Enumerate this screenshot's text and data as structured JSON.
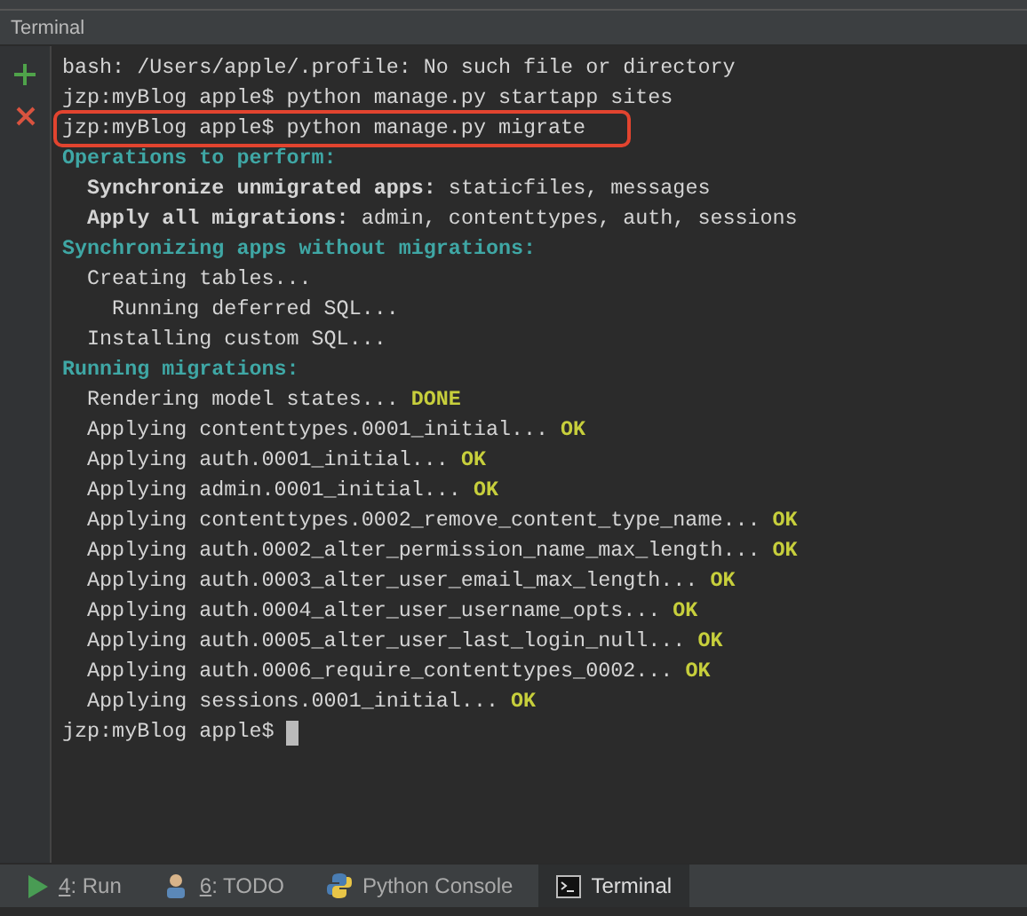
{
  "panel": {
    "title": "Terminal"
  },
  "toolbar": [
    {
      "kind": "add"
    },
    {
      "kind": "close"
    }
  ],
  "lines": [
    {
      "highlighted": false,
      "segments": [
        {
          "kind": "plain",
          "text": "bash: /Users/apple/.profile: No such file or directory"
        }
      ]
    },
    {
      "highlighted": false,
      "segments": [
        {
          "kind": "plain",
          "text": "jzp:myBlog apple$ python manage.py startapp sites"
        }
      ]
    },
    {
      "highlighted": true,
      "segments": [
        {
          "kind": "plain",
          "text": "jzp:myBlog apple$ python manage.py migrate"
        }
      ]
    },
    {
      "highlighted": false,
      "segments": [
        {
          "kind": "heading",
          "text": "Operations to perform:"
        }
      ]
    },
    {
      "highlighted": false,
      "segments": [
        {
          "kind": "bold",
          "text": "  Synchronize unmigrated apps:"
        },
        {
          "kind": "plain",
          "text": " staticfiles, messages"
        }
      ]
    },
    {
      "highlighted": false,
      "segments": [
        {
          "kind": "bold",
          "text": "  Apply all migrations:"
        },
        {
          "kind": "plain",
          "text": " admin, contenttypes, auth, sessions"
        }
      ]
    },
    {
      "highlighted": false,
      "segments": [
        {
          "kind": "heading",
          "text": "Synchronizing apps without migrations:"
        }
      ]
    },
    {
      "highlighted": false,
      "segments": [
        {
          "kind": "plain",
          "text": "  Creating tables..."
        }
      ]
    },
    {
      "highlighted": false,
      "segments": [
        {
          "kind": "plain",
          "text": "    Running deferred SQL..."
        }
      ]
    },
    {
      "highlighted": false,
      "segments": [
        {
          "kind": "plain",
          "text": "  Installing custom SQL..."
        }
      ]
    },
    {
      "highlighted": false,
      "segments": [
        {
          "kind": "heading",
          "text": "Running migrations:"
        }
      ]
    },
    {
      "highlighted": false,
      "segments": [
        {
          "kind": "plain",
          "text": "  Rendering model states... "
        },
        {
          "kind": "ok",
          "text": "DONE"
        }
      ]
    },
    {
      "highlighted": false,
      "segments": [
        {
          "kind": "plain",
          "text": "  Applying contenttypes.0001_initial... "
        },
        {
          "kind": "ok",
          "text": "OK"
        }
      ]
    },
    {
      "highlighted": false,
      "segments": [
        {
          "kind": "plain",
          "text": "  Applying auth.0001_initial... "
        },
        {
          "kind": "ok",
          "text": "OK"
        }
      ]
    },
    {
      "highlighted": false,
      "segments": [
        {
          "kind": "plain",
          "text": "  Applying admin.0001_initial... "
        },
        {
          "kind": "ok",
          "text": "OK"
        }
      ]
    },
    {
      "highlighted": false,
      "segments": [
        {
          "kind": "plain",
          "text": "  Applying contenttypes.0002_remove_content_type_name... "
        },
        {
          "kind": "ok",
          "text": "OK"
        }
      ]
    },
    {
      "highlighted": false,
      "segments": [
        {
          "kind": "plain",
          "text": "  Applying auth.0002_alter_permission_name_max_length... "
        },
        {
          "kind": "ok",
          "text": "OK"
        }
      ]
    },
    {
      "highlighted": false,
      "segments": [
        {
          "kind": "plain",
          "text": "  Applying auth.0003_alter_user_email_max_length... "
        },
        {
          "kind": "ok",
          "text": "OK"
        }
      ]
    },
    {
      "highlighted": false,
      "segments": [
        {
          "kind": "plain",
          "text": "  Applying auth.0004_alter_user_username_opts... "
        },
        {
          "kind": "ok",
          "text": "OK"
        }
      ]
    },
    {
      "highlighted": false,
      "segments": [
        {
          "kind": "plain",
          "text": "  Applying auth.0005_alter_user_last_login_null... "
        },
        {
          "kind": "ok",
          "text": "OK"
        }
      ]
    },
    {
      "highlighted": false,
      "segments": [
        {
          "kind": "plain",
          "text": "  Applying auth.0006_require_contenttypes_0002... "
        },
        {
          "kind": "ok",
          "text": "OK"
        }
      ]
    },
    {
      "highlighted": false,
      "segments": [
        {
          "kind": "plain",
          "text": "  Applying sessions.0001_initial... "
        },
        {
          "kind": "ok",
          "text": "OK"
        }
      ]
    }
  ],
  "prompt": {
    "text": "jzp:myBlog apple$ "
  },
  "tabs": [
    {
      "kind": "run",
      "key": "4",
      "label": ": Run",
      "selected": false
    },
    {
      "kind": "todo",
      "key": "6",
      "label": ": TODO",
      "selected": false
    },
    {
      "kind": "python",
      "label": "Python Console",
      "selected": false
    },
    {
      "kind": "terminal",
      "label": "Terminal",
      "selected": true
    }
  ]
}
